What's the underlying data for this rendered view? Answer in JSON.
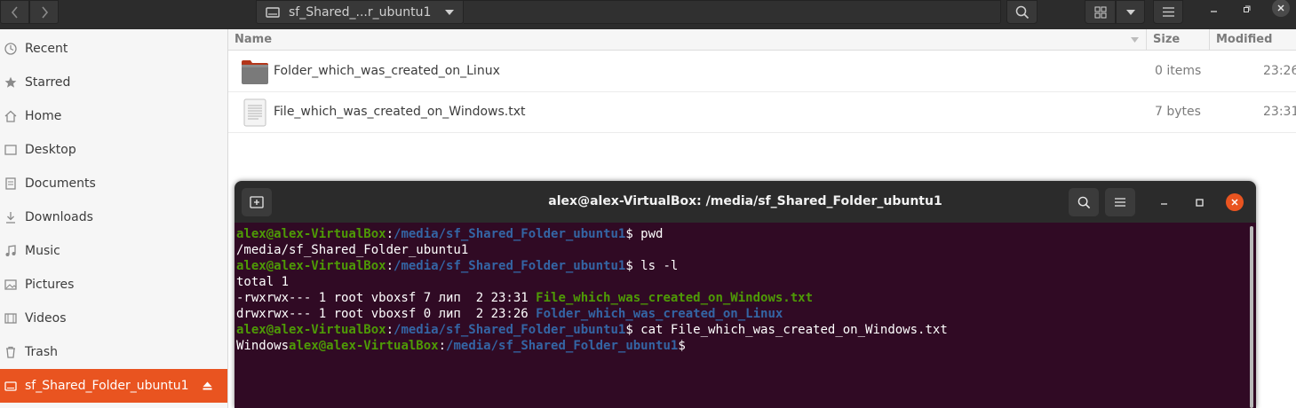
{
  "files_window": {
    "path_label": "sf_Shared_...r_ubuntu1"
  },
  "sidebar": {
    "items": [
      {
        "label": "Recent",
        "icon": "clock-icon"
      },
      {
        "label": "Starred",
        "icon": "star-icon"
      },
      {
        "label": "Home",
        "icon": "home-icon"
      },
      {
        "label": "Desktop",
        "icon": "desktop-icon"
      },
      {
        "label": "Documents",
        "icon": "documents-icon"
      },
      {
        "label": "Downloads",
        "icon": "downloads-icon"
      },
      {
        "label": "Music",
        "icon": "music-icon"
      },
      {
        "label": "Pictures",
        "icon": "pictures-icon"
      },
      {
        "label": "Videos",
        "icon": "videos-icon"
      },
      {
        "label": "Trash",
        "icon": "trash-icon"
      },
      {
        "label": "sf_Shared_Folder_ubuntu1",
        "icon": "drive-icon",
        "active": true
      }
    ],
    "accent_color": "#e95420"
  },
  "file_list": {
    "columns": {
      "name": "Name",
      "size": "Size",
      "modified": "Modified"
    },
    "rows": [
      {
        "name": "Folder_which_was_created_on_Linux",
        "size": "0 items",
        "modified": "23:26",
        "icon": "folder-icon"
      },
      {
        "name": "File_which_was_created_on_Windows.txt",
        "size": "7 bytes",
        "modified": "23:31",
        "icon": "text-file-icon"
      }
    ]
  },
  "terminal": {
    "title": "alex@alex-VirtualBox: /media/sf_Shared_Folder_ubuntu1",
    "bg_color": "#300a24",
    "lines": {
      "l1_user": "alex@alex-VirtualBox",
      "l1_colon": ":",
      "l1_path": "/media/sf_Shared_Folder_ubuntu1",
      "l1_cmd": "$ pwd",
      "l2": "/media/sf_Shared_Folder_ubuntu1",
      "l3_user": "alex@alex-VirtualBox",
      "l3_colon": ":",
      "l3_path": "/media/sf_Shared_Folder_ubuntu1",
      "l3_cmd": "$ ls -l",
      "l4": "total 1",
      "l5_meta": "-rwxrwx--- 1 root vboxsf 7 лип  2 23:31 ",
      "l5_name": "File_which_was_created_on_Windows.txt",
      "l6_meta": "drwxrwx--- 1 root vboxsf 0 лип  2 23:26 ",
      "l6_name": "Folder_which_was_created_on_Linux",
      "l7_user": "alex@alex-VirtualBox",
      "l7_colon": ":",
      "l7_path": "/media/sf_Shared_Folder_ubuntu1",
      "l7_cmd": "$ cat File_which_was_created_on_Windows.txt",
      "l8_out": "Windows",
      "l8_user": "alex@alex-VirtualBox",
      "l8_colon": ":",
      "l8_path": "/media/sf_Shared_Folder_ubuntu1",
      "l8_cmd": "$ "
    }
  }
}
